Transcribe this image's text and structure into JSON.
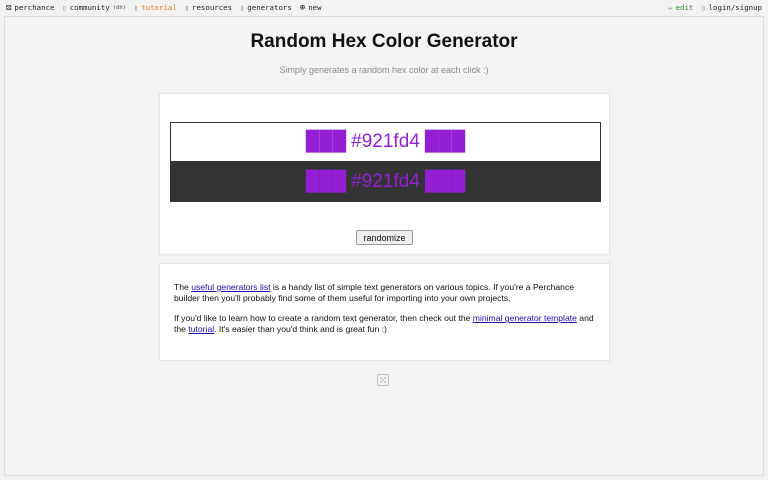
{
  "nav": {
    "brand": "perchance",
    "community": "community",
    "community_tag": "(dh)",
    "tutorial": "tutorial",
    "resources": "resources",
    "generators": "generators",
    "new": "new",
    "edit": "edit",
    "login": "login/signup"
  },
  "page": {
    "title": "Random Hex Color Generator",
    "subtitle": "Simply generates a random hex color at each click :)"
  },
  "generator": {
    "hex": "#921fd4",
    "color": "#921fd4",
    "blocks": "███",
    "button_label": "randomize"
  },
  "info": {
    "p1_before": "The ",
    "p1_link": "useful generators list",
    "p1_after": " is a handy list of simple text generators on various topics. If you're a Perchance builder then you'll probably find some of them useful for importing into your own projects.",
    "p2_before": "If you'd like to learn how to create a random text generator, then check out the ",
    "p2_link1": "minimal generator template",
    "p2_mid": " and the ",
    "p2_link2": "tutorial",
    "p2_after": ". It's easier than you'd think and is great fun :)"
  },
  "colors": {
    "light_bg": "#ffffff",
    "dark_bg": "#333333",
    "tutorial_link": "#d9822b",
    "edit_link": "#2e8b2e",
    "hyperlink": "#1a0dab"
  }
}
